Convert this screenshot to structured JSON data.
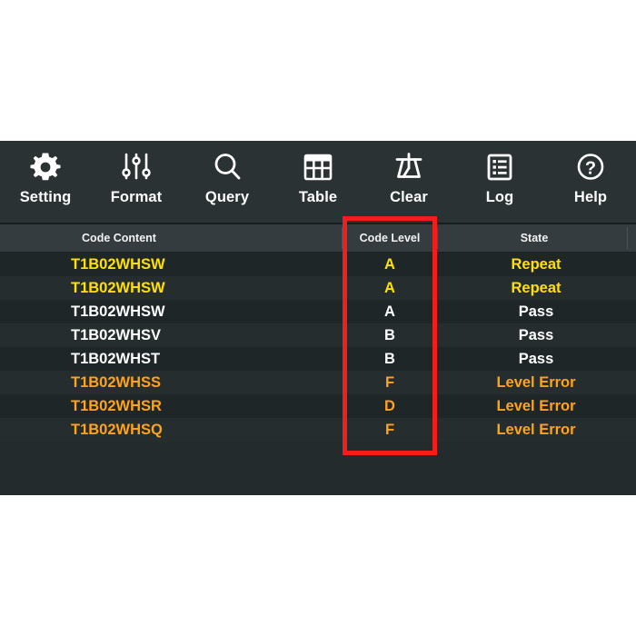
{
  "toolbar": {
    "items": [
      {
        "label": "Setting",
        "icon": "gear-icon"
      },
      {
        "label": "Format",
        "icon": "sliders-icon"
      },
      {
        "label": "Query",
        "icon": "search-icon"
      },
      {
        "label": "Table",
        "icon": "table-grid-icon"
      },
      {
        "label": "Clear",
        "icon": "broom-icon"
      },
      {
        "label": "Log",
        "icon": "list-document-icon"
      },
      {
        "label": "Help",
        "icon": "question-circle-icon"
      }
    ]
  },
  "table": {
    "columns": [
      "Code Content",
      "Code Level",
      "State"
    ],
    "rows": [
      {
        "code": "T1B02WHSW",
        "level": "A",
        "state": "Repeat",
        "color": "#ffe100"
      },
      {
        "code": "T1B02WHSW",
        "level": "A",
        "state": "Repeat",
        "color": "#ffe100"
      },
      {
        "code": "T1B02WHSW",
        "level": "A",
        "state": "Pass",
        "color": "#ffffff"
      },
      {
        "code": "T1B02WHSV",
        "level": "B",
        "state": "Pass",
        "color": "#ffffff"
      },
      {
        "code": "T1B02WHST",
        "level": "B",
        "state": "Pass",
        "color": "#ffffff"
      },
      {
        "code": "T1B02WHSS",
        "level": "F",
        "state": "Level Error",
        "color": "#ffa31a"
      },
      {
        "code": "T1B02WHSR",
        "level": "D",
        "state": "Level Error",
        "color": "#ffa31a"
      },
      {
        "code": "T1B02WHSQ",
        "level": "F",
        "state": "Level Error",
        "color": "#ffa31a"
      }
    ]
  },
  "highlight": {
    "name": "code-level-column-highlight",
    "color": "#f41c1c"
  },
  "colors": {
    "panel_background": "#242b2d",
    "toolbar_background": "#2b3234",
    "header_background": "#353c3f",
    "row_odd": "#1f2628",
    "row_even": "#262d2f",
    "status_repeat": "#ffe100",
    "status_pass": "#ffffff",
    "status_error": "#ffa31a"
  }
}
